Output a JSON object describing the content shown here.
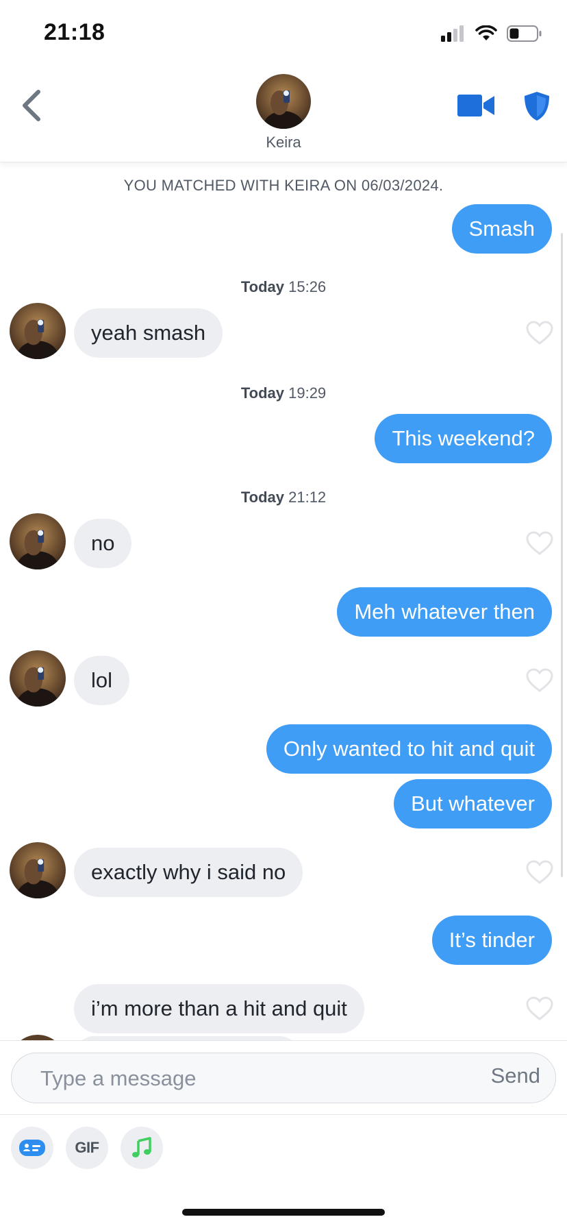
{
  "status_bar": {
    "time": "21:18",
    "battery_level": 0.35
  },
  "header": {
    "name": "Keira",
    "back_icon": "chevron-left-icon",
    "video_icon": "video-camera-icon",
    "safety_icon": "shield-icon"
  },
  "chat": {
    "match_notice": "YOU MATCHED WITH KEIRA ON 06/03/2024.",
    "timestamps": [
      {
        "day": "Today",
        "time": "15:26"
      },
      {
        "day": "Today",
        "time": "19:29"
      },
      {
        "day": "Today",
        "time": "21:12"
      }
    ],
    "messages": [
      {
        "direction": "sent",
        "text": "Smash"
      },
      {
        "direction": "received",
        "text": "yeah smash"
      },
      {
        "direction": "sent",
        "text": "This weekend?"
      },
      {
        "direction": "received",
        "text": "no"
      },
      {
        "direction": "sent",
        "text": "Meh whatever then"
      },
      {
        "direction": "received",
        "text": "lol"
      },
      {
        "direction": "sent",
        "text": "Only wanted to hit and quit"
      },
      {
        "direction": "sent",
        "text": "But whatever"
      },
      {
        "direction": "received",
        "text": "exactly why i said no"
      },
      {
        "direction": "sent",
        "text": "It’s tinder"
      },
      {
        "direction": "received",
        "text": "i’m more than a hit and quit"
      }
    ]
  },
  "composer": {
    "placeholder": "Type a message",
    "send_label": "Send",
    "tools": [
      {
        "name": "card-icon"
      },
      {
        "label": "GIF"
      },
      {
        "name": "music-note-icon"
      }
    ]
  },
  "colors": {
    "sent_bubble": "#3f9df5",
    "received_bubble": "#eceef2",
    "accent_blue": "#1e6fd9",
    "music_green": "#3ecf5e"
  }
}
